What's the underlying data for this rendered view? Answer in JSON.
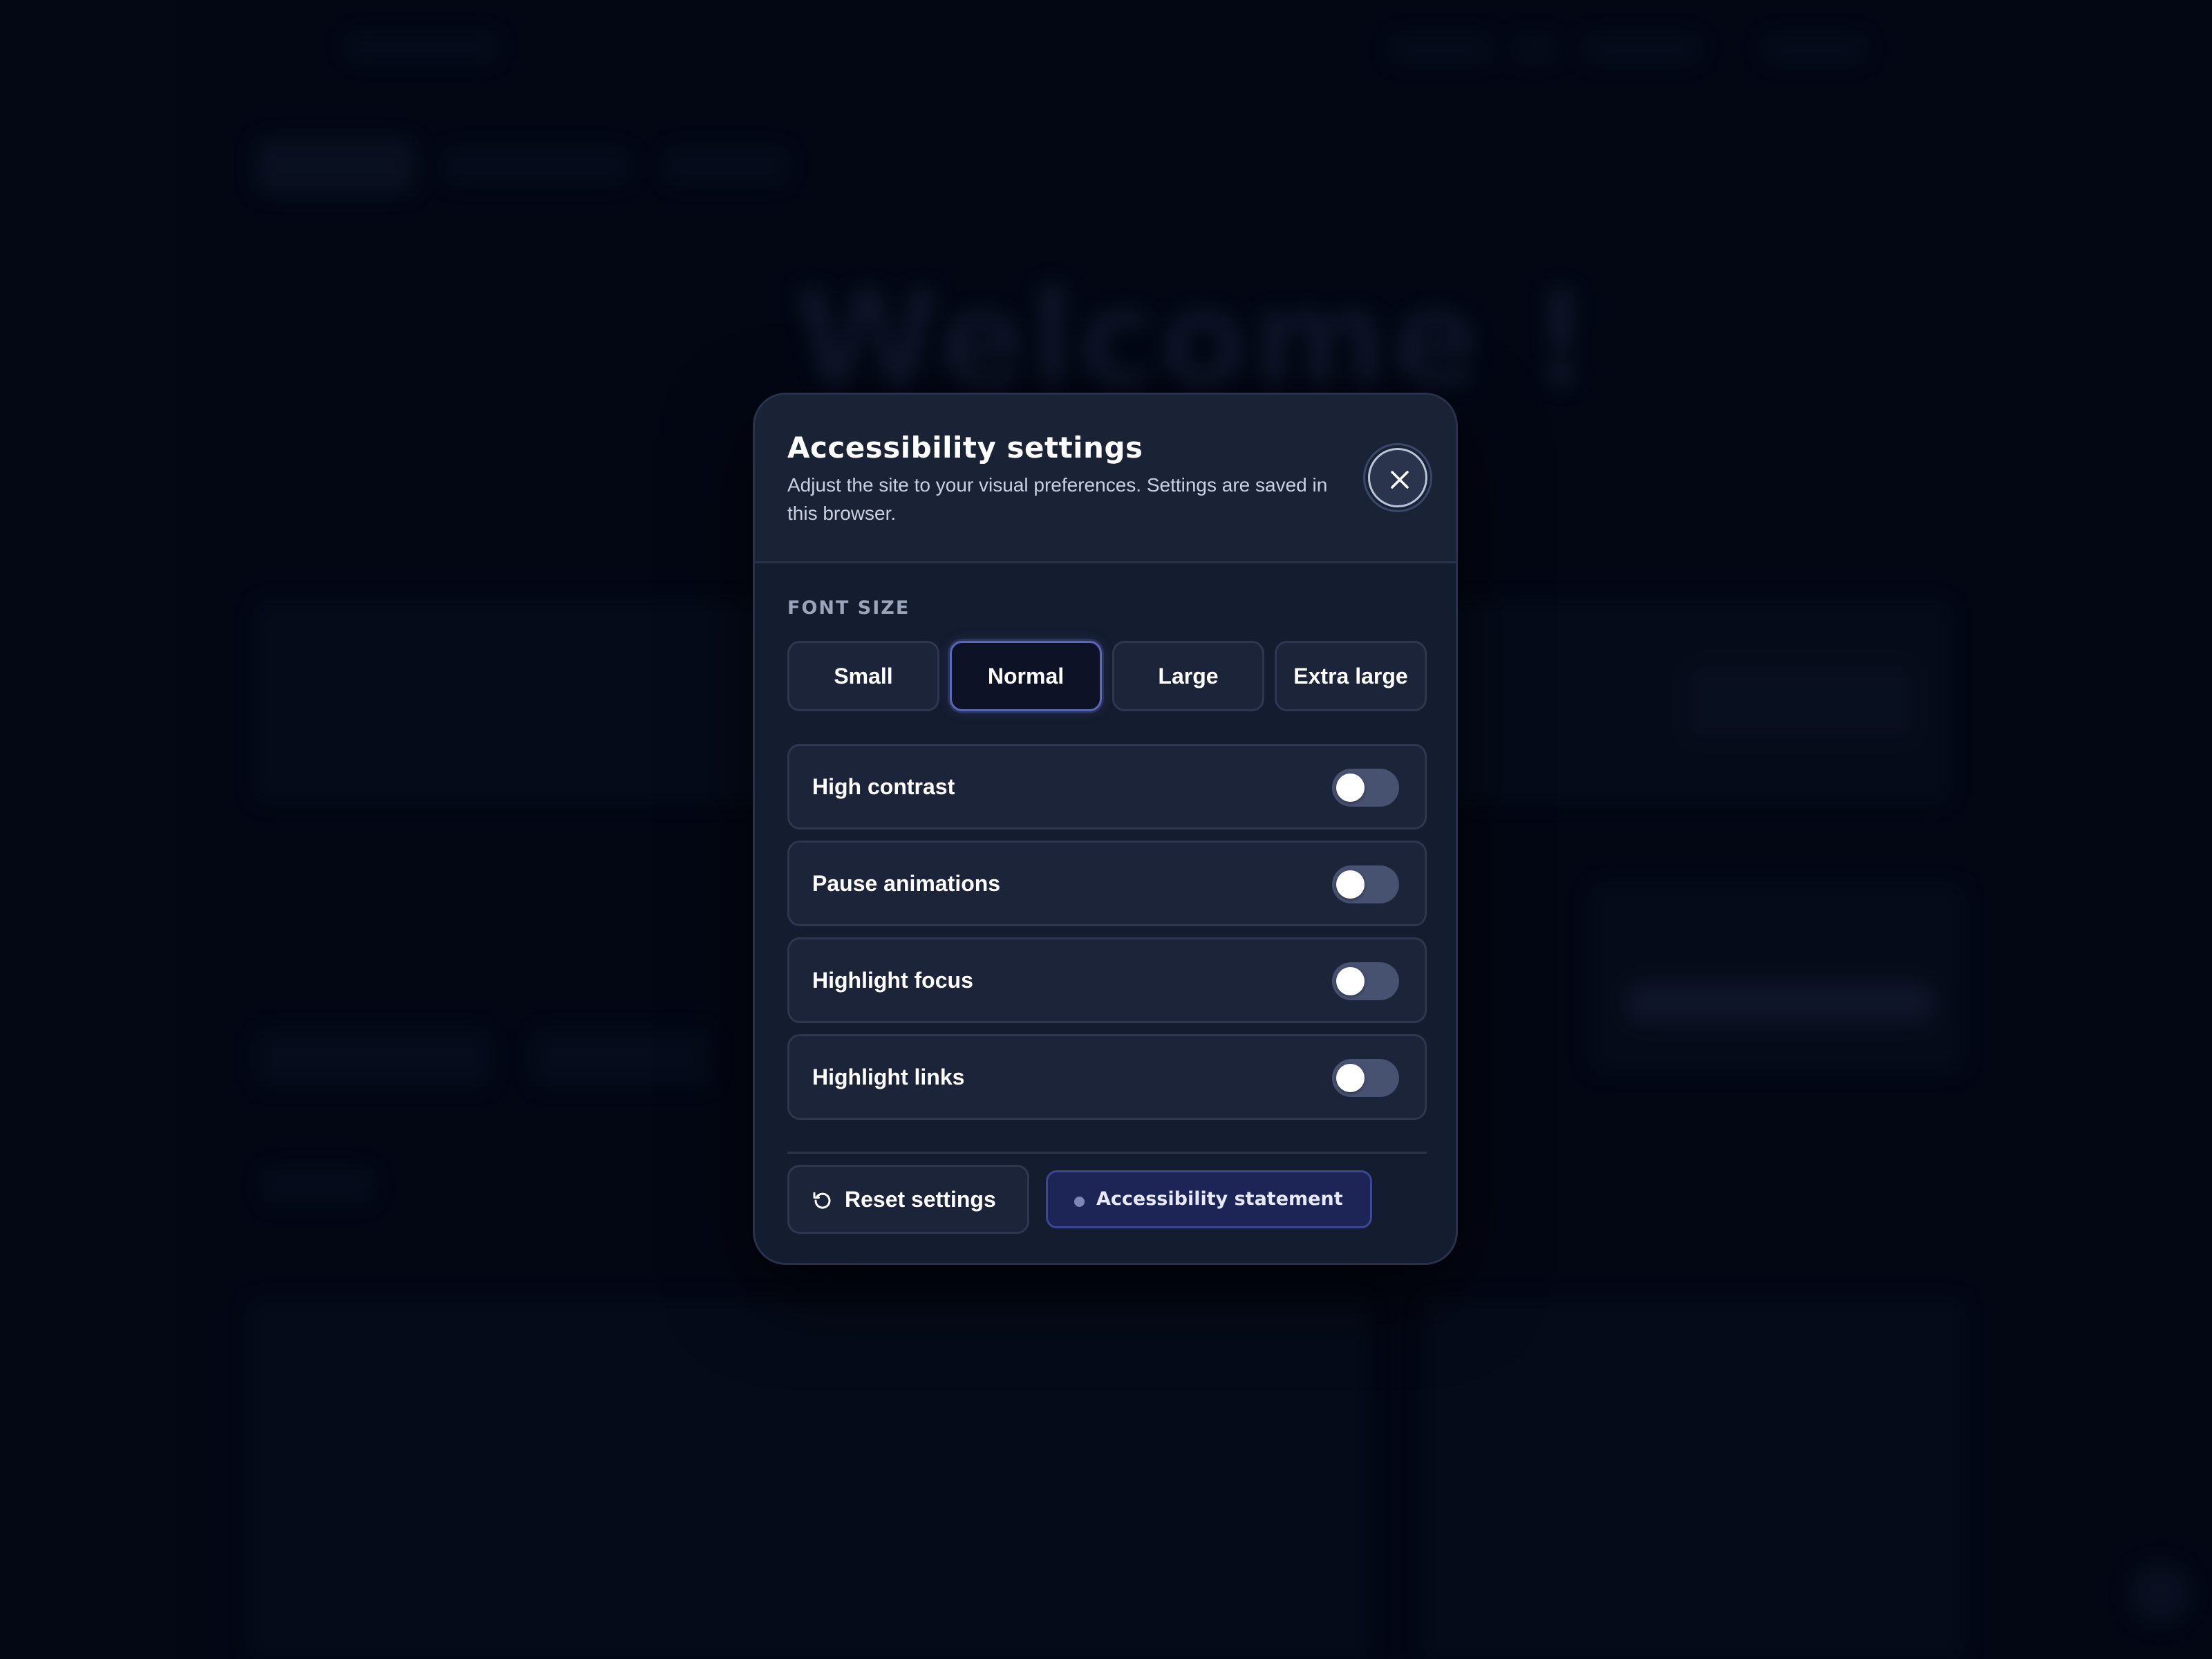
{
  "background": {
    "headline": "Welcome !"
  },
  "dialog": {
    "title": "Accessibility settings",
    "subtitle": "Adjust the site to your visual preferences. Settings are saved in this browser.",
    "close_icon": "close-icon",
    "font_size": {
      "label": "FONT SIZE",
      "options": [
        "Small",
        "Normal",
        "Large",
        "Extra large"
      ],
      "selected": "Normal"
    },
    "toggles": [
      {
        "label": "High contrast",
        "on": false
      },
      {
        "label": "Pause animations",
        "on": false
      },
      {
        "label": "Highlight focus",
        "on": false
      },
      {
        "label": "Highlight links",
        "on": false
      }
    ],
    "reset": {
      "label": "Reset settings",
      "icon": "reset-icon"
    },
    "statement": {
      "label": "Accessibility statement"
    }
  },
  "colors": {
    "background": "#040816",
    "dialog": "#141c2f",
    "selected_border": "#5b66b8",
    "statement_button": "#1d2557",
    "toggle_off": "#475170"
  }
}
